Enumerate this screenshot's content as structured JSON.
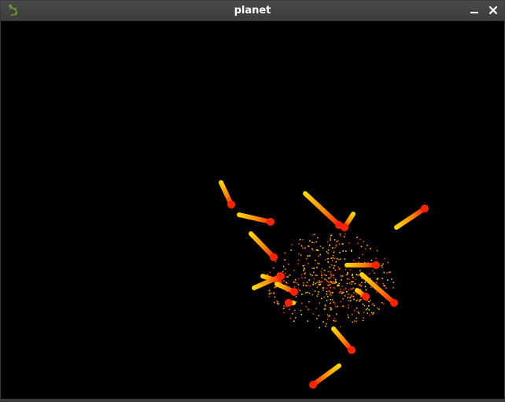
{
  "window": {
    "title": "planet",
    "app_icon": "gecko-icon",
    "controls": [
      {
        "name": "minimize-button",
        "icon": "minimize-icon"
      },
      {
        "name": "close-button",
        "icon": "close-icon"
      }
    ]
  },
  "scene": {
    "background": "#000000",
    "particle_colors": [
      "#ff2a00",
      "#ff6a00",
      "#ffb400",
      "#ffe000"
    ]
  }
}
